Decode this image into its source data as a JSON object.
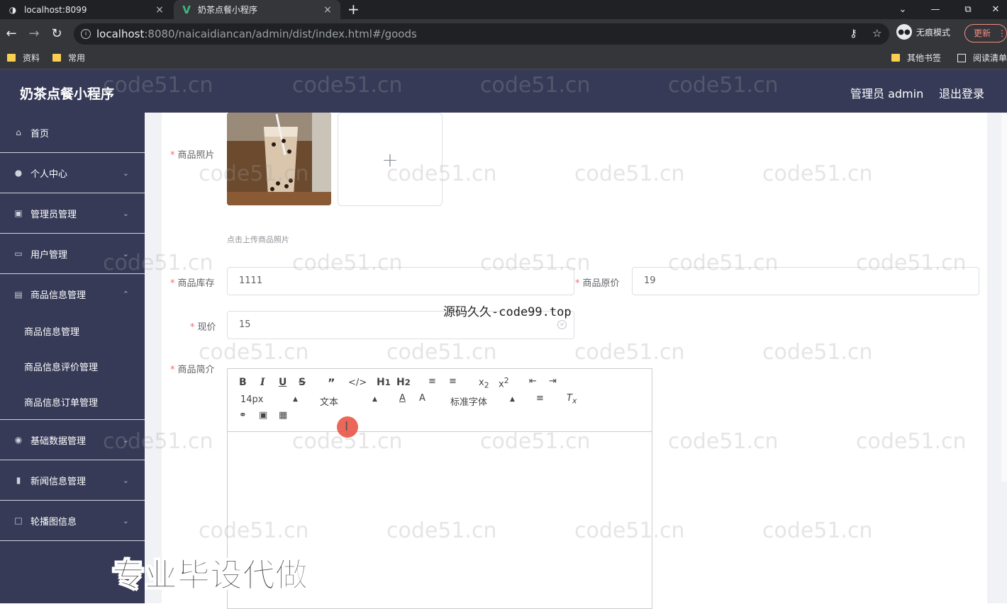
{
  "browser": {
    "tabs": [
      {
        "title": "localhost:8099",
        "close": "×"
      },
      {
        "title": "奶茶点餐小程序",
        "close": "×"
      }
    ],
    "new_tab": "+",
    "url_host": "localhost",
    "url_path": ":8080/naicaidiancan/admin/dist/index.html#/goods",
    "incognito_label": "无痕模式",
    "update_label": "更新",
    "bookmarks": [
      "资料",
      "常用"
    ],
    "bookmarks_right": [
      "其他书签",
      "阅读清单"
    ]
  },
  "app": {
    "title": "奶茶点餐小程序",
    "header_user": "管理员 admin",
    "header_logout": "退出登录"
  },
  "sidebar": {
    "items": [
      {
        "label": "首页",
        "icon": "home-icon"
      },
      {
        "label": "个人中心",
        "icon": "user-icon"
      },
      {
        "label": "管理员管理",
        "icon": "clipboard-icon"
      },
      {
        "label": "用户管理",
        "icon": "id-card-icon"
      },
      {
        "label": "商品信息管理",
        "icon": "briefcase-icon"
      },
      {
        "label": "基础数据管理",
        "icon": "compass-icon"
      },
      {
        "label": "新闻信息管理",
        "icon": "library-icon"
      },
      {
        "label": "轮播图信息",
        "icon": "chat-icon"
      }
    ],
    "sub_items": [
      "商品信息管理",
      "商品信息评价管理",
      "商品信息订单管理"
    ]
  },
  "form": {
    "photo_label": "商品照片",
    "photo_hint": "点击上传商品照片",
    "stock_label": "商品库存",
    "stock_value": "1111",
    "orig_price_label": "商品原价",
    "orig_price_value": "19",
    "price_label": "现价",
    "price_value": "15",
    "intro_label": "商品简介",
    "required_mark": "*",
    "upload_plus": "+"
  },
  "editor": {
    "font_size": "14px",
    "header_select": "文本",
    "font_family": "标准字体"
  },
  "overlays": {
    "top_text": "源码久久-code99.top",
    "big_text": "专业毕设代做",
    "watermark": "code51.cn"
  }
}
